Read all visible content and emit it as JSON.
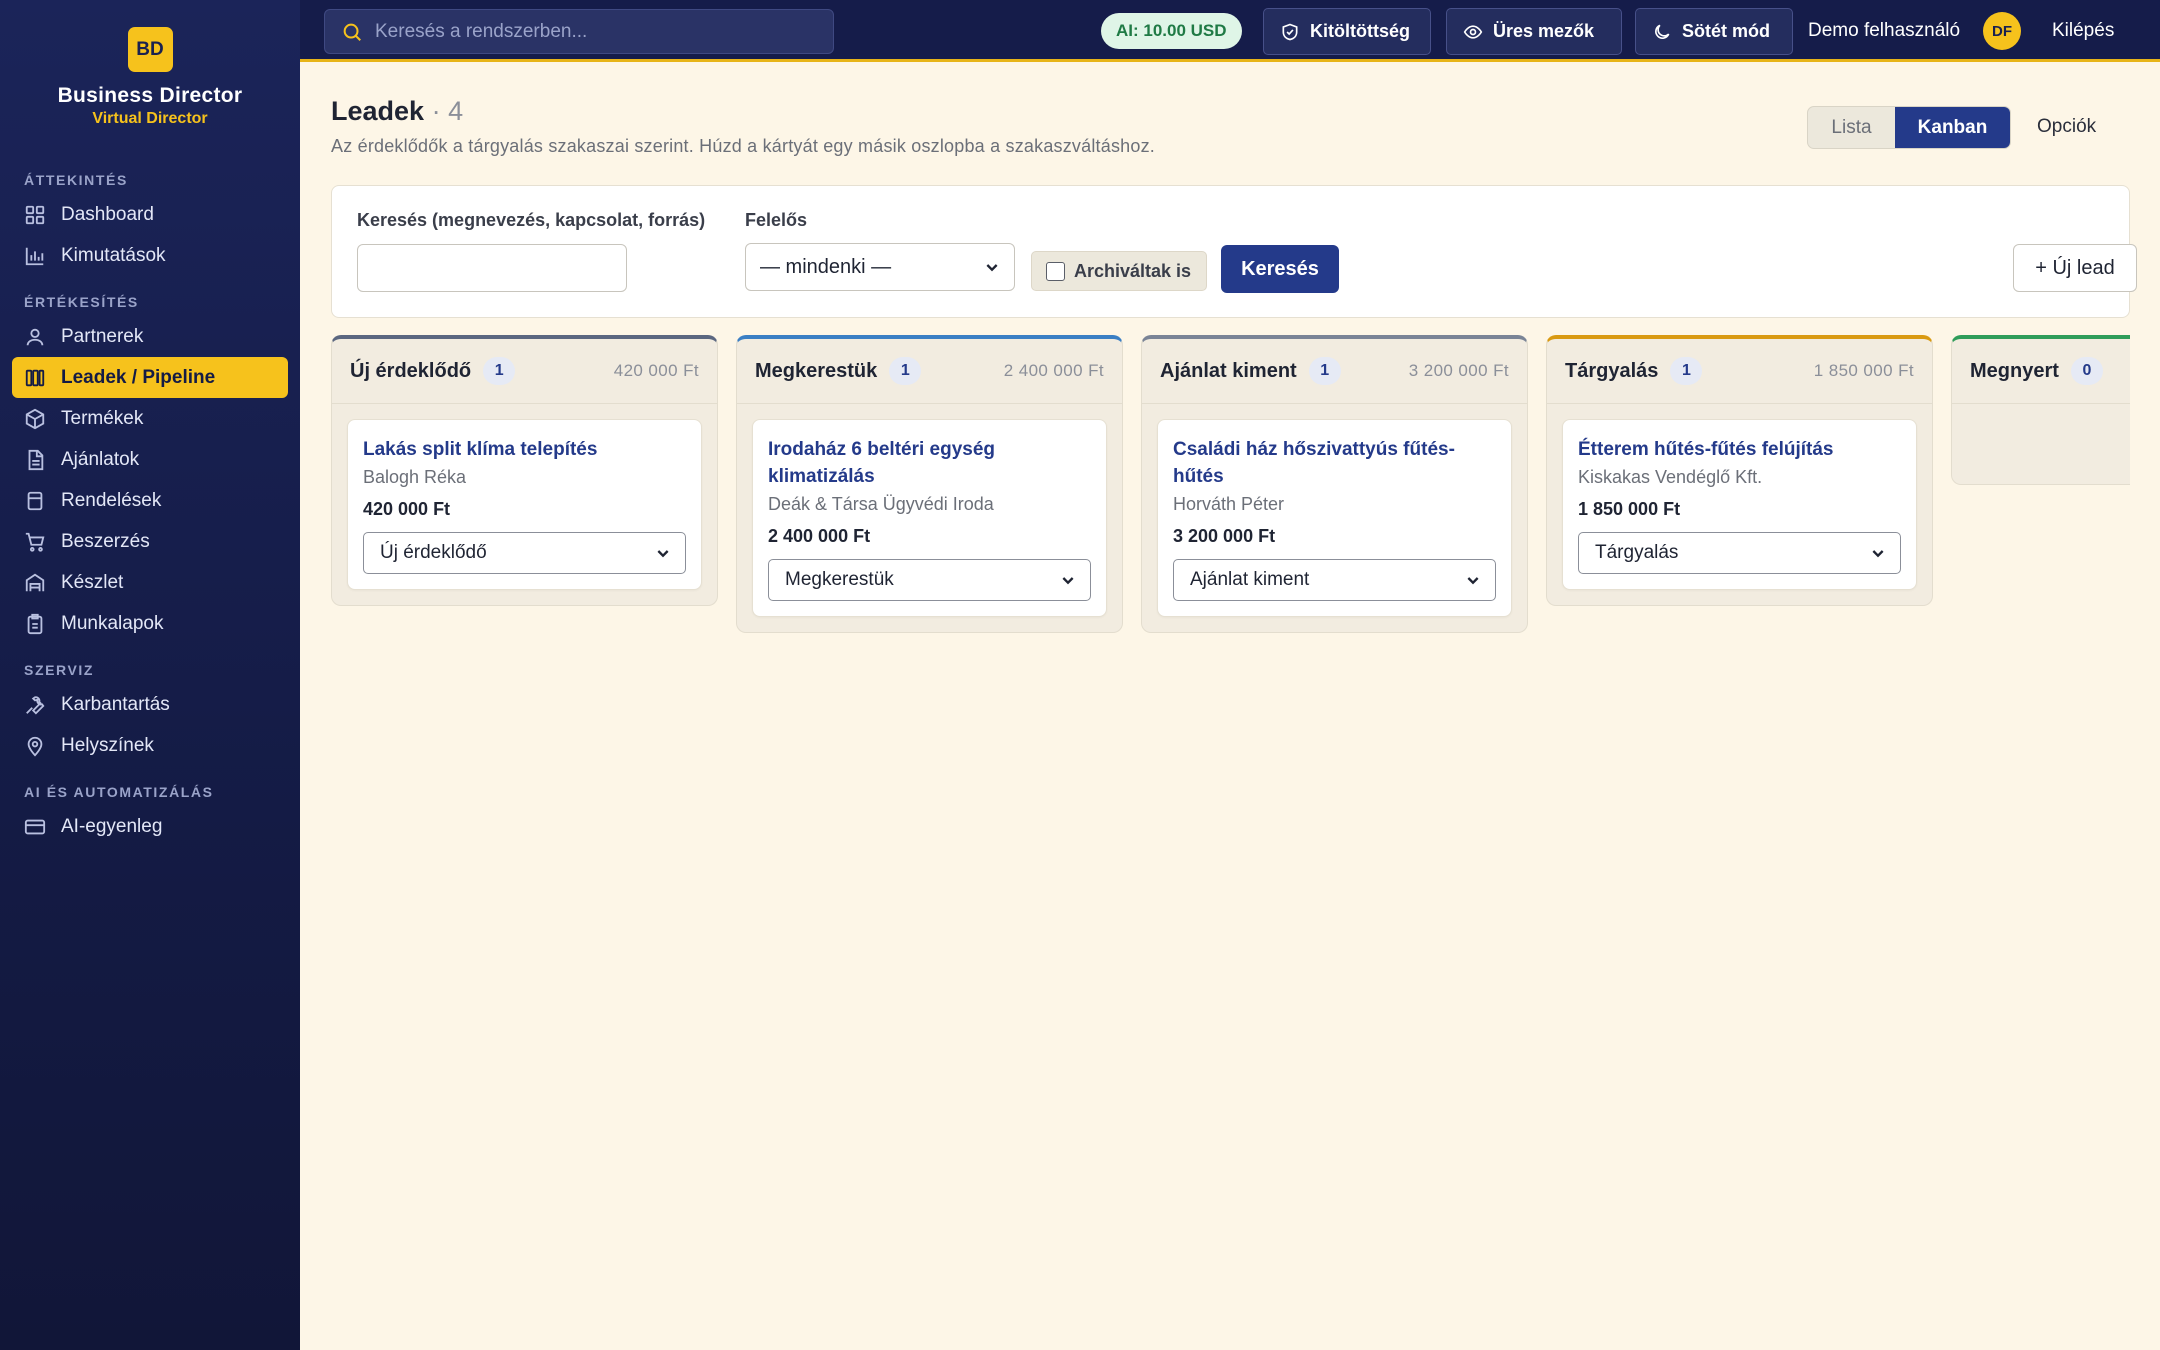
{
  "brand": {
    "logo": "BD",
    "name": "Business Director",
    "subtitle": "Virtual Director"
  },
  "sidebar": {
    "sections": [
      {
        "title": "ÁTTEKINTÉS",
        "items": [
          {
            "label": "Dashboard",
            "icon": "grid-icon"
          },
          {
            "label": "Kimutatások",
            "icon": "bar-chart-icon"
          }
        ]
      },
      {
        "title": "ÉRTÉKESÍTÉS",
        "items": [
          {
            "label": "Partnerek",
            "icon": "user-icon"
          },
          {
            "label": "Leadek / Pipeline",
            "icon": "columns-icon",
            "active": true
          },
          {
            "label": "Termékek",
            "icon": "box-icon"
          },
          {
            "label": "Ajánlatok",
            "icon": "document-icon"
          },
          {
            "label": "Rendelések",
            "icon": "receipt-icon"
          },
          {
            "label": "Beszerzés",
            "icon": "cart-icon"
          },
          {
            "label": "Készlet",
            "icon": "warehouse-icon"
          },
          {
            "label": "Munkalapok",
            "icon": "clipboard-icon"
          }
        ]
      },
      {
        "title": "SZERVIZ",
        "items": [
          {
            "label": "Karbantartás",
            "icon": "wrench-icon"
          },
          {
            "label": "Helyszínek",
            "icon": "map-pin-icon"
          }
        ]
      },
      {
        "title": "AI ÉS AUTOMATIZÁLÁS",
        "items": [
          {
            "label": "AI-egyenleg",
            "icon": "wallet-icon"
          }
        ]
      }
    ]
  },
  "topbar": {
    "search_placeholder": "Keresés a rendszerben...",
    "ai_balance": "AI: 10.00 USD",
    "buttons": {
      "completeness": "Kitöltöttség",
      "empty_fields": "Üres mezők",
      "dark_mode": "Sötét mód"
    },
    "user_name": "Demo felhasználó",
    "avatar": "DF",
    "logout": "Kilépés"
  },
  "page": {
    "title": "Leadek",
    "count": "· 4",
    "description": "Az érdeklődők a tárgyalás szakaszai szerint. Húzd a kártyát egy másik oszlopba a szakaszváltáshoz.",
    "view_toggle": {
      "list": "Lista",
      "kanban": "Kanban"
    },
    "options": "Opciók"
  },
  "filters": {
    "search_label": "Keresés (megnevezés, kapcsolat, forrás)",
    "search_value": "",
    "owner_label": "Felelős",
    "owner_value": "— mindenki —",
    "archived_label": "Archiváltak is",
    "search_button": "Keresés",
    "new_lead_button": "+ Új lead"
  },
  "kanban": {
    "columns": [
      {
        "title": "Új érdeklődő",
        "count": "1",
        "sum": "420 000 Ft",
        "color": "#5b6780",
        "cards": [
          {
            "title": "Lakás split klíma telepítés",
            "contact": "Balogh Réka",
            "amount": "420 000 Ft",
            "stage": "Új érdeklődő"
          }
        ]
      },
      {
        "title": "Megkerestük",
        "count": "1",
        "sum": "2 400 000 Ft",
        "color": "#3b7fc4",
        "cards": [
          {
            "title": "Irodaház 6 beltéri egység klimatizálás",
            "contact": "Deák & Társa Ügyvédi Iroda",
            "amount": "2 400 000 Ft",
            "stage": "Megkerestük"
          }
        ]
      },
      {
        "title": "Ajánlat kiment",
        "count": "1",
        "sum": "3 200 000 Ft",
        "color": "#7a8496",
        "cards": [
          {
            "title": "Családi ház hőszivattyús fűtés-hűtés",
            "contact": "Horváth Péter",
            "amount": "3 200 000 Ft",
            "stage": "Ajánlat kiment"
          }
        ]
      },
      {
        "title": "Tárgyalás",
        "count": "1",
        "sum": "1 850 000 Ft",
        "color": "#d99a12",
        "cards": [
          {
            "title": "Étterem hűtés-fűtés felújítás",
            "contact": "Kiskakas Vendéglő Kft.",
            "amount": "1 850 000 Ft",
            "stage": "Tárgyalás"
          }
        ]
      },
      {
        "title": "Megnyert",
        "count": "0",
        "sum": "",
        "color": "#2f9d5a",
        "cards": []
      }
    ]
  }
}
